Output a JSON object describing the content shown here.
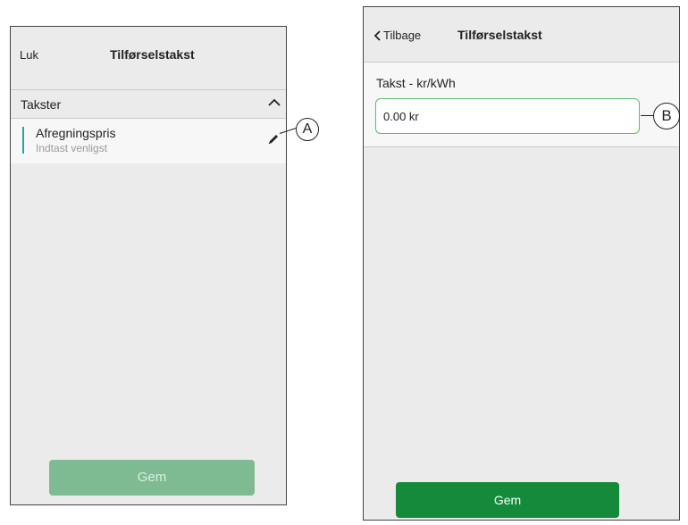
{
  "screen_a": {
    "header": {
      "close_label": "Luk",
      "title": "Tilførselstakst"
    },
    "section": {
      "label": "Takster",
      "icon": "chevron-up-icon"
    },
    "item": {
      "title": "Afregningspris",
      "subtitle": "Indtast venligst",
      "edit_icon": "pencil-icon"
    },
    "save_label": "Gem",
    "save_state": "disabled"
  },
  "screen_b": {
    "header": {
      "back_label": "Tilbage",
      "title": "Tilførselstakst",
      "back_icon": "chevron-left-icon"
    },
    "field": {
      "label": "Takst -",
      "unit": "kr/kWh",
      "value": "0.00 kr"
    },
    "save_label": "Gem"
  },
  "callouts": {
    "a": "A",
    "b": "B"
  },
  "colors": {
    "accent": "#2ba49b",
    "save_enabled": "#158a3b",
    "save_disabled": "#7ebb92",
    "input_border": "#5bbf69",
    "screen_bg": "#ebebeb"
  }
}
